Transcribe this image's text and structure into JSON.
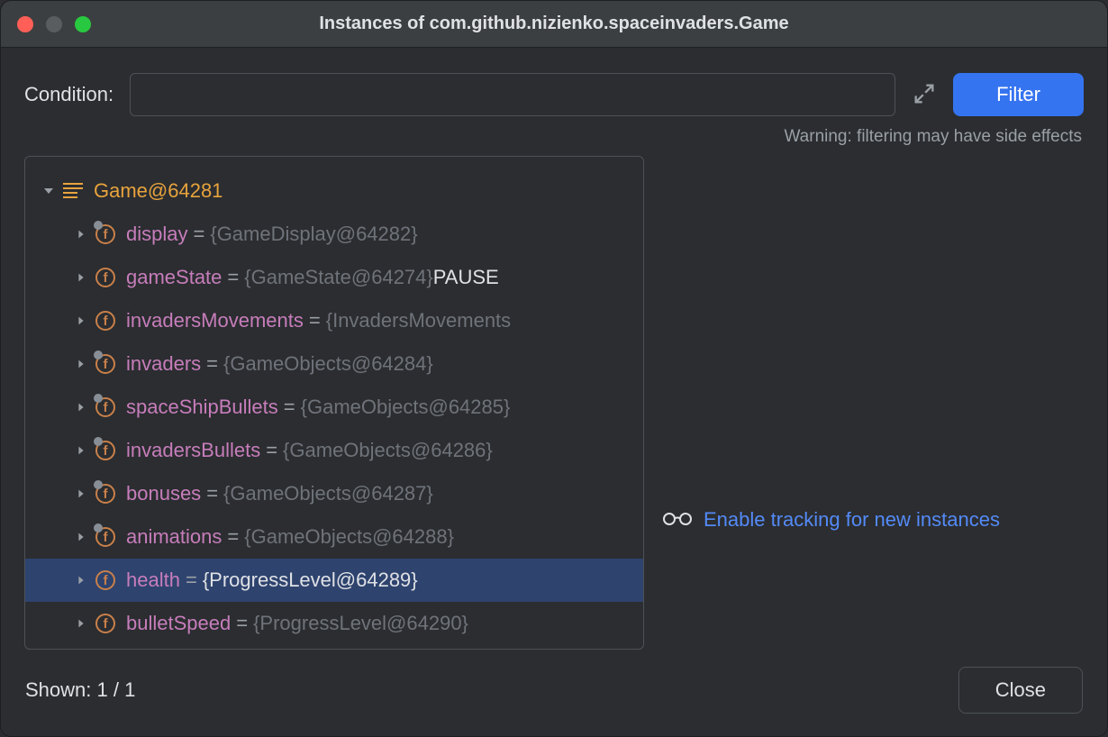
{
  "title": "Instances of com.github.nizienko.spaceinvaders.Game",
  "condition": {
    "label": "Condition:",
    "value": ""
  },
  "filter_button": "Filter",
  "warning": "Warning: filtering may have side effects",
  "tree": {
    "root": {
      "label": "Game@64281"
    },
    "fields": [
      {
        "name": "display",
        "value": "{GameDisplay@64282}",
        "extra": "",
        "pin": true,
        "selected": false
      },
      {
        "name": "gameState",
        "value": "{GameState@64274}",
        "extra": "PAUSE",
        "pin": false,
        "selected": false
      },
      {
        "name": "invadersMovements",
        "value": "{InvadersMovements",
        "extra": "",
        "pin": false,
        "selected": false
      },
      {
        "name": "invaders",
        "value": "{GameObjects@64284}",
        "extra": "",
        "pin": true,
        "selected": false
      },
      {
        "name": "spaceShipBullets",
        "value": "{GameObjects@64285}",
        "extra": "",
        "pin": true,
        "selected": false
      },
      {
        "name": "invadersBullets",
        "value": "{GameObjects@64286}",
        "extra": "",
        "pin": true,
        "selected": false
      },
      {
        "name": "bonuses",
        "value": "{GameObjects@64287}",
        "extra": "",
        "pin": true,
        "selected": false
      },
      {
        "name": "animations",
        "value": "{GameObjects@64288}",
        "extra": "",
        "pin": true,
        "selected": false
      },
      {
        "name": "health",
        "value": "{ProgressLevel@64289}",
        "extra": "",
        "pin": false,
        "selected": true
      },
      {
        "name": "bulletSpeed",
        "value": "{ProgressLevel@64290}",
        "extra": "",
        "pin": false,
        "selected": false
      }
    ]
  },
  "tracking_link": "Enable tracking for new instances",
  "shown": "Shown: 1 / 1",
  "close_button": "Close"
}
